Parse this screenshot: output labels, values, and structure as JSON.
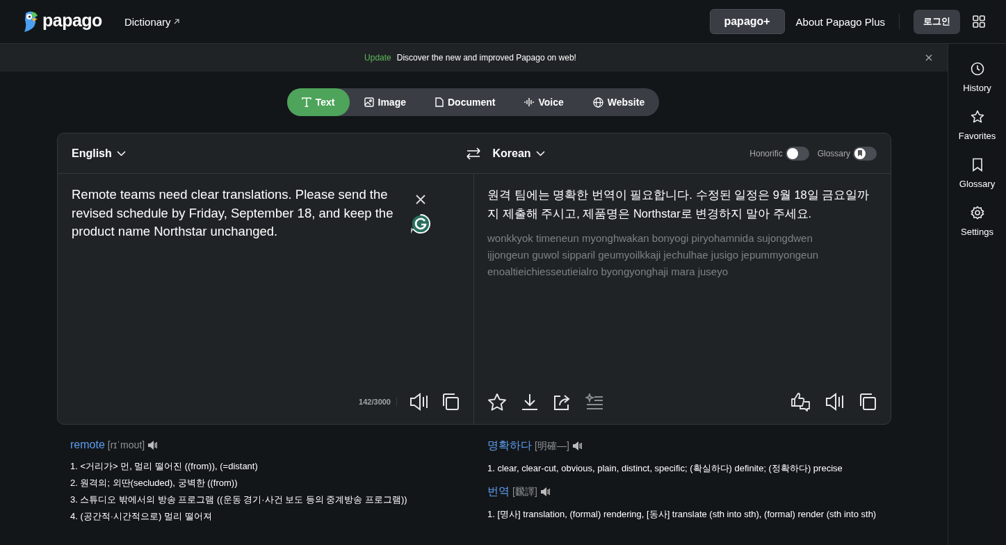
{
  "header": {
    "logo": "papago",
    "dictionary_link": "Dictionary",
    "plus_badge": "papago+",
    "plus_link": "About Papago Plus",
    "login_button": "로그인"
  },
  "banner": {
    "tag": "Update",
    "message": "Discover the new and improved Papago on web!"
  },
  "tabs": [
    {
      "label": "Text",
      "selected": true
    },
    {
      "label": "Image",
      "selected": false
    },
    {
      "label": "Document",
      "selected": false
    },
    {
      "label": "Voice",
      "selected": false
    },
    {
      "label": "Website",
      "selected": false
    }
  ],
  "source": {
    "language": "English",
    "text": "Remote teams need clear translations. Please send the revised schedule by Friday, September 18, and keep the product name Northstar unchanged.",
    "char_count": "142/3000"
  },
  "target": {
    "language": "Korean",
    "text": "원격 팀에는 명확한 번역이 필요합니다. 수정된 일정은 9월 18일 금요일까지 제출해 주시고, 제품명은 Northstar로 변경하지 말아 주세요.",
    "romanization": "wonkkyok timeneun myonghwakan bonyogi piryohamnida sujongdwen ijjongeun guwol sipparil geumyoilkkaji jechulhae jusigo jepummyongeun enoaltieichiesseutieialro byongyonghaji mara juseyo"
  },
  "options": [
    {
      "label": "Honorific",
      "on": false
    },
    {
      "label": "Glossary",
      "on": false
    }
  ],
  "sidebar": {
    "items": [
      {
        "label": "History"
      },
      {
        "label": "Favorites"
      },
      {
        "label": "Glossary"
      },
      {
        "label": "Settings"
      }
    ]
  },
  "dictionary": {
    "source_entries": [
      {
        "word": "remote",
        "pronunciation": "[rɪˈmoʊt]",
        "meanings": [
          "1. <거리가> 먼, 멀리 떨어진 ((from)), (=distant)",
          "2. 원격의; 외딴(secluded), 궁벽한 ((from))",
          "3. 스튜디오 밖에서의 방송 프로그램 ((운동 경기·사건 보도 등의 중계방송 프로그램))",
          "4. (공간적·시간적으로) 멀리 떨어져"
        ]
      }
    ],
    "target_entries": [
      {
        "word": "명확하다",
        "pronunciation": "[明確—]",
        "meanings": [
          "1. clear, clear-cut, obvious, plain, distinct, specific; (확실하다) definite; (정확하다) precise"
        ]
      },
      {
        "word": "번역",
        "pronunciation": "[飜譯]",
        "meanings": [
          "1. [명사] translation, (formal) rendering, [동사] translate (sth into sth), (formal) render (sth into sth)"
        ]
      }
    ]
  }
}
